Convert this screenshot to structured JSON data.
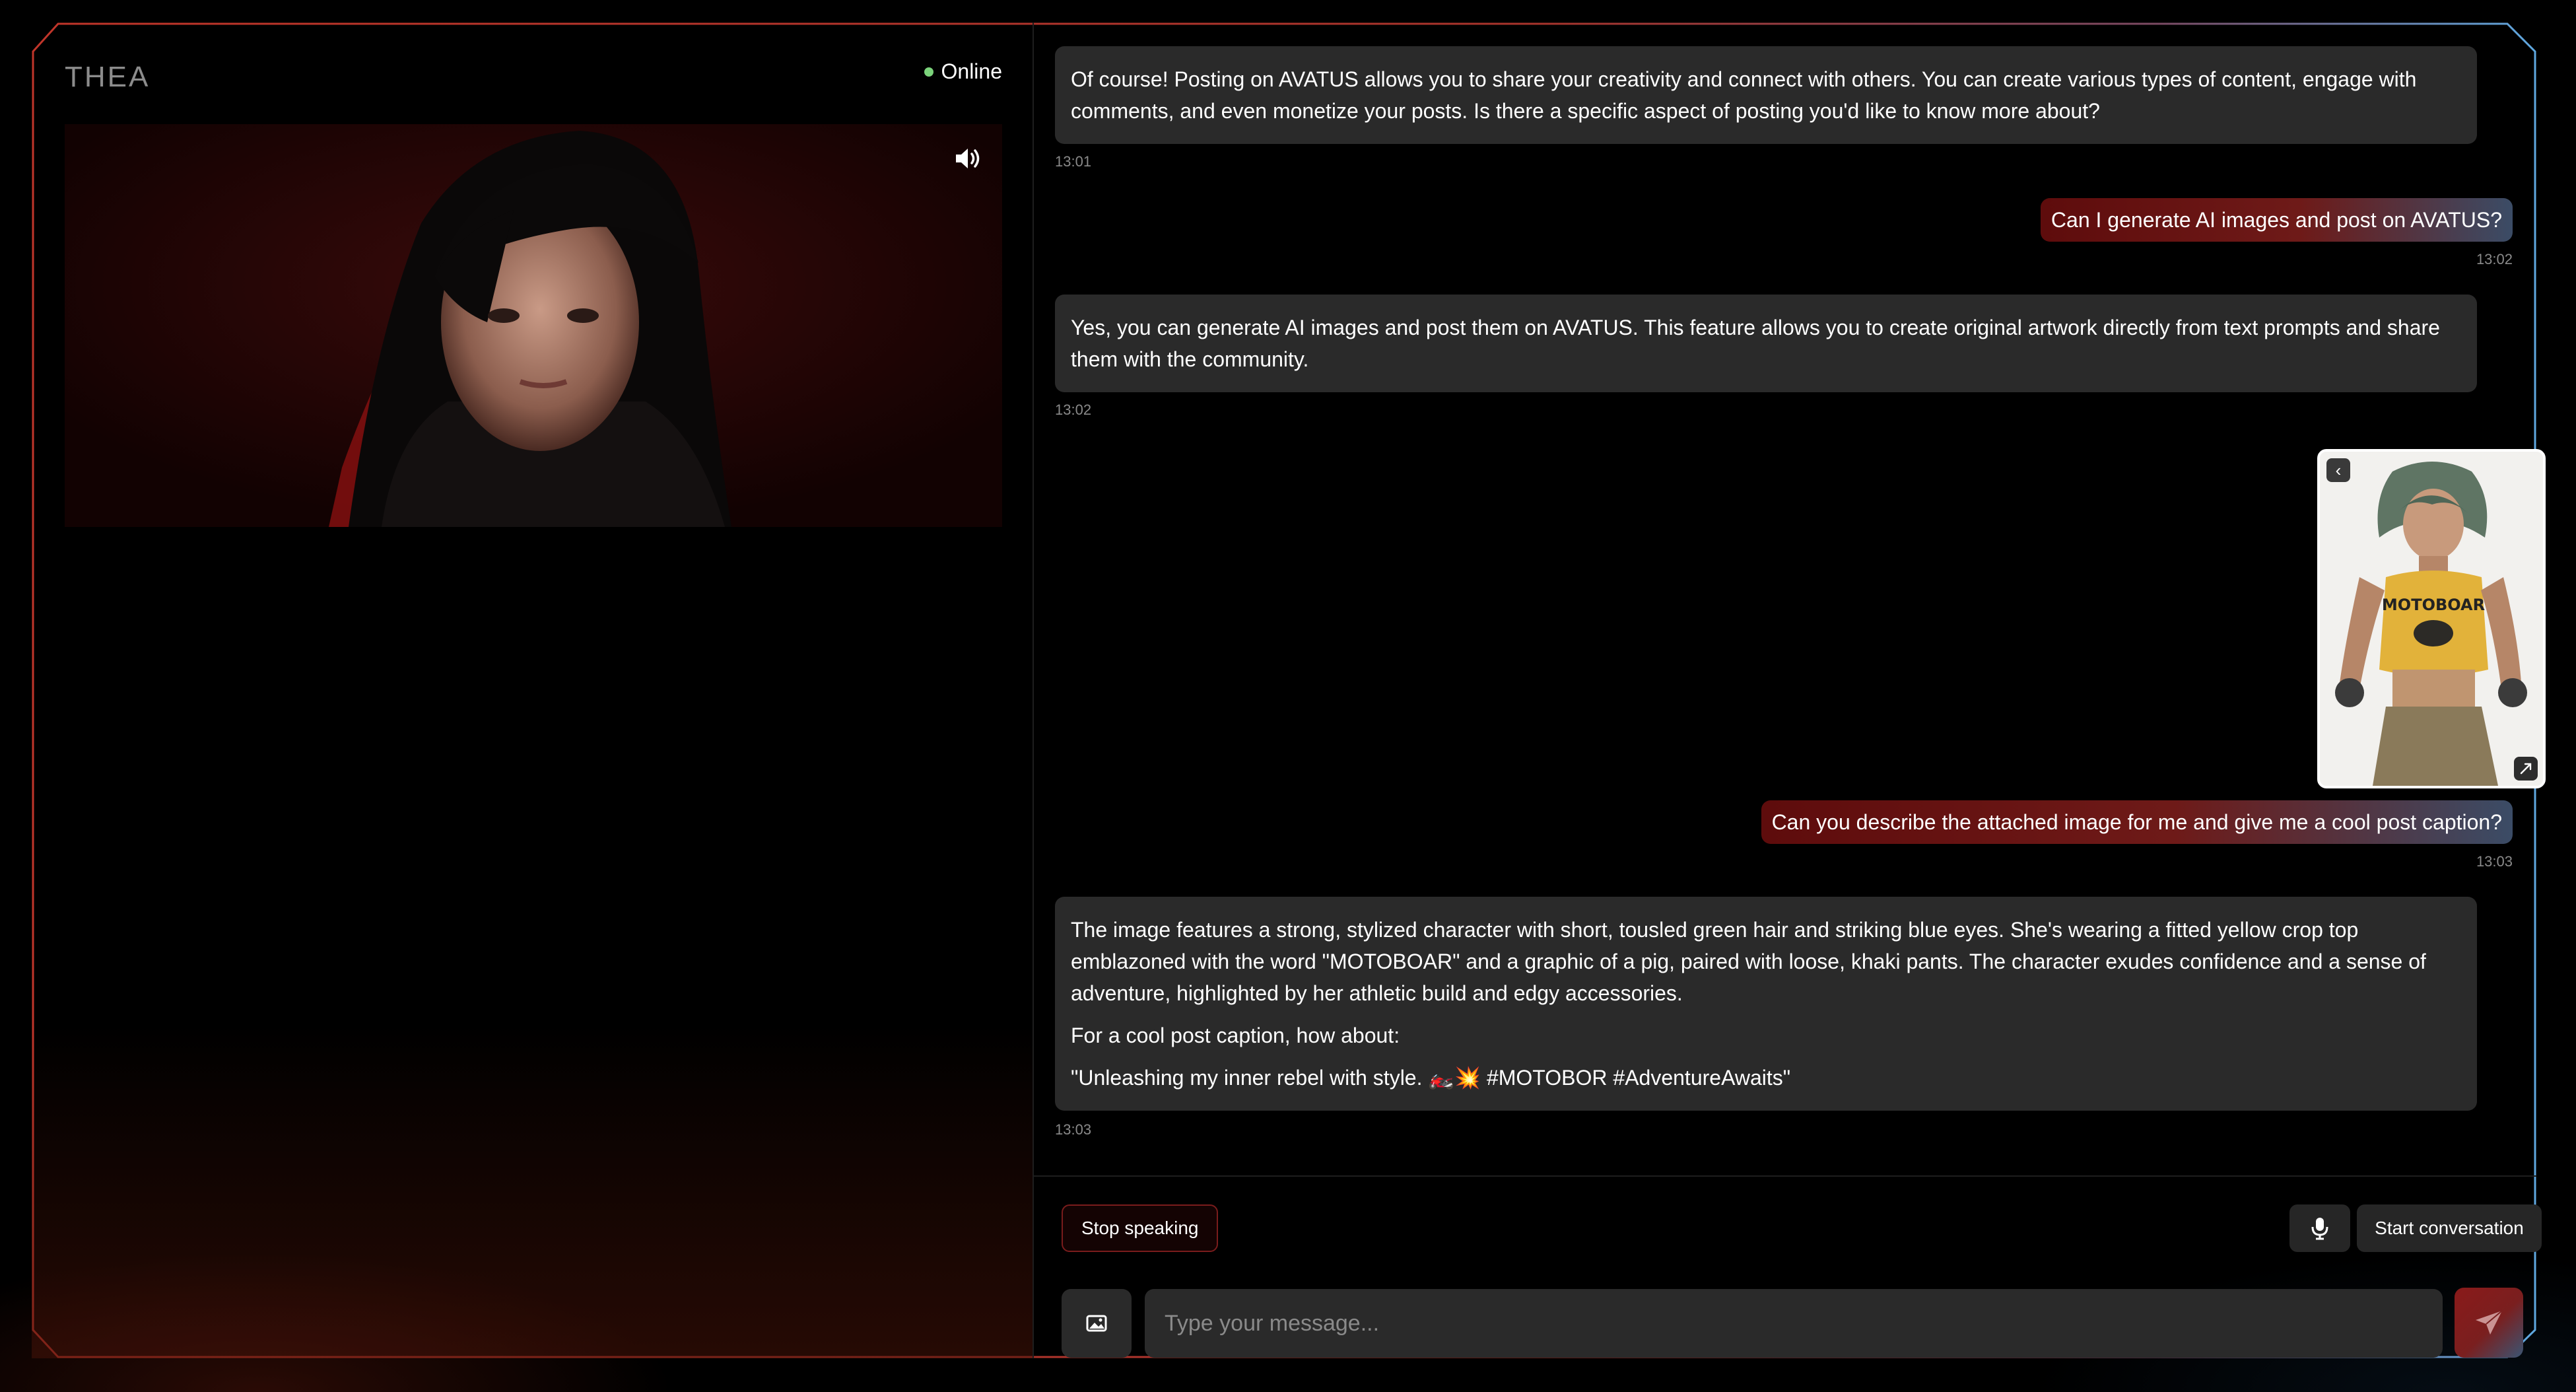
{
  "app": {
    "name": "THEA",
    "status": "Online"
  },
  "colors": {
    "online": "#7bd37b",
    "accent_red": "#7a1c1c",
    "accent_blue": "#3a5573"
  },
  "video": {
    "speaker_icon": "speaker-icon"
  },
  "chat": {
    "messages": [
      {
        "role": "ai",
        "paragraphs": [
          "Of course! Posting on AVATUS allows you to share your creativity and connect with others. You can create various types of content, engage with comments, and even monetize your posts. Is there a specific aspect of posting you'd like to know more about?"
        ],
        "time": "13:01"
      },
      {
        "role": "user",
        "text": "Can I generate AI images and post on AVATUS?",
        "time": "13:02"
      },
      {
        "role": "ai",
        "paragraphs": [
          "Yes, you can generate AI images and post them on AVATUS. This feature allows you to create original artwork directly from text prompts and share them with the community."
        ],
        "time": "13:02"
      },
      {
        "role": "user",
        "attachment": {
          "shirt_text": "MOTOBOAR",
          "back_icon": "chevron-left-icon",
          "expand_icon": "expand-icon"
        },
        "text": "Can you describe the attached image for me and give me a cool post caption?",
        "time": "13:03"
      },
      {
        "role": "ai",
        "paragraphs": [
          "The image features a strong, stylized character with short, tousled green hair and striking blue eyes. She's wearing a fitted yellow crop top emblazoned with the word \"MOTOBOAR\" and a graphic of a pig, paired with loose, khaki pants. The character exudes confidence and a sense of adventure, highlighted by her athletic build and edgy accessories.",
          "For a cool post caption, how about:",
          "\"Unleashing my inner rebel with style. 🏍️💥 #MOTOBOR #AdventureAwaits\""
        ],
        "time": "13:03"
      }
    ]
  },
  "composer": {
    "stop_label": "Stop speaking",
    "start_label": "Start conversation",
    "input_placeholder": "Type your message...",
    "input_value": ""
  }
}
